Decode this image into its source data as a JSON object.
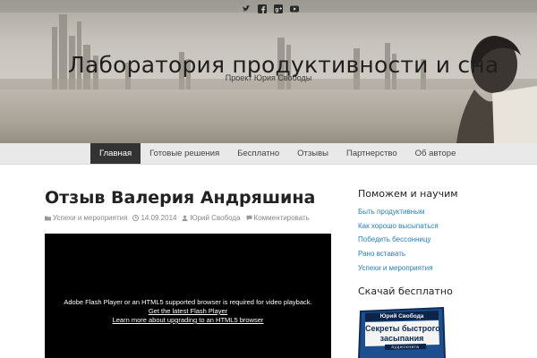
{
  "header": {
    "site_title": "Лаборатория продуктивности и сна",
    "site_description": "Проект Юрия Свободы",
    "social_icons": [
      "twitter-icon",
      "facebook-icon",
      "google-plus-icon",
      "youtube-icon"
    ]
  },
  "nav": {
    "items": [
      {
        "label": "Главная",
        "active": true
      },
      {
        "label": "Готовые решения",
        "active": false
      },
      {
        "label": "Бесплатно",
        "active": false
      },
      {
        "label": "Отзывы",
        "active": false
      },
      {
        "label": "Партнерство",
        "active": false
      },
      {
        "label": "Об авторе",
        "active": false
      }
    ]
  },
  "post": {
    "title": "Отзыв Валерия Андряшина",
    "category": "Успехи и мероприятия",
    "date": "14.09.2014",
    "author": "Юрий Свобода",
    "comment_link": "Комментировать"
  },
  "player": {
    "message": "Adobe Flash Player or an HTML5 supported browser is required for video playback.",
    "link1": "Get the latest Flash Player",
    "link2": "Learn more about upgrading to an HTML5 browser"
  },
  "sidebar": {
    "widget1_title": "Поможем и научим",
    "links": [
      "Быть продуктивным",
      "Как хорошо высыпаться",
      "Победить бессонницу",
      "Рано вставать",
      "Успехи и мероприятия"
    ],
    "widget2_title": "Скачай бесплатно",
    "book": {
      "author": "Юрий Свобода",
      "title_line1": "Секреты быстрого",
      "title_line2": "засыпания",
      "subtitle": "аудиокнига"
    }
  },
  "colors": {
    "nav_active_bg": "#333333",
    "link": "#2b7fb8",
    "player_bg": "#000000",
    "book_blue": "#1d4f8f"
  }
}
